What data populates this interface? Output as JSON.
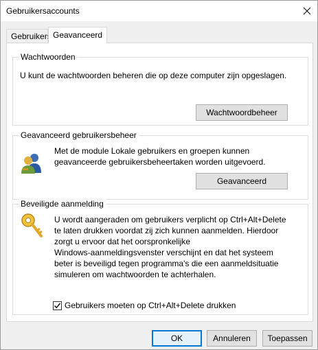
{
  "window": {
    "title": "Gebruikersaccounts"
  },
  "tabs": [
    {
      "label": "Gebruikers"
    },
    {
      "label": "Geavanceerd"
    }
  ],
  "passwords": {
    "legend": "Wachtwoorden",
    "description": "U kunt de wachtwoorden beheren die op deze computer zijn opgeslagen.",
    "button_label": "Wachtwoordbeheer"
  },
  "advanced_user_mgmt": {
    "legend": "Geavanceerd gebruikersbeheer",
    "description_line1": "Met de module Lokale gebruikers en groepen kunnen",
    "description_line2": "geavanceerde gebruikersbeheertaken worden uitgevoerd.",
    "button_label": "Geavanceerd",
    "icon": "users-icon"
  },
  "secure_logon": {
    "legend": "Beveiligde aanmelding",
    "lines": [
      "U wordt aangeraden om gebruikers verplicht op Ctrl+Alt+Delete",
      "te laten drukken voordat zij zich kunnen aanmelden. Hierdoor",
      "zorgt u ervoor dat het oorspronkelijke",
      "Windows-aanmeldingsvenster verschijnt en dat het systeem",
      "beter is beveiligd tegen programma's die een aanmeldsituatie",
      "simuleren om wachtwoorden te achterhalen."
    ],
    "checkbox_label": "Gebruikers moeten op Ctrl+Alt+Delete drukken",
    "checkbox_checked": true,
    "icon": "key-icon"
  },
  "footer": {
    "ok_label": "OK",
    "cancel_label": "Annuleren",
    "apply_label": "Toepassen"
  },
  "colors": {
    "accent": "#0078d7",
    "panel_bg": "#ffffff",
    "window_bg": "#f0f0f0"
  }
}
